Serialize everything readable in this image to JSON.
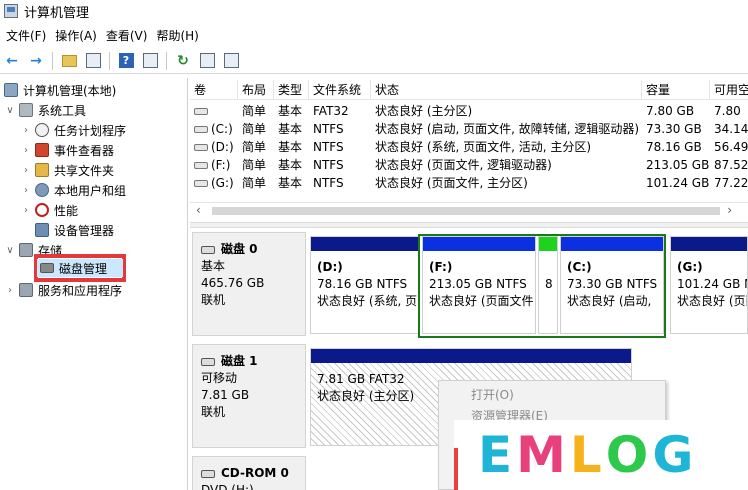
{
  "window": {
    "title": "计算机管理"
  },
  "menu": [
    {
      "label": "文件(F)"
    },
    {
      "label": "操作(A)"
    },
    {
      "label": "查看(V)"
    },
    {
      "label": "帮助(H)"
    }
  ],
  "toolbar": {
    "icons": [
      "back-arrow-icon",
      "forward-arrow-icon",
      "up-folder-icon",
      "show-hide-tree-icon",
      "help-icon",
      "help-pane-icon",
      "refresh-icon",
      "properties-icon",
      "export-icon"
    ]
  },
  "tree": {
    "root": "计算机管理(本地)",
    "system_tools": "系统工具",
    "task_scheduler": "任务计划程序",
    "event_viewer": "事件查看器",
    "shared_folders": "共享文件夹",
    "local_users": "本地用户和组",
    "performance": "性能",
    "device_manager": "设备管理器",
    "storage": "存储",
    "disk_management": "磁盘管理",
    "services_apps": "服务和应用程序"
  },
  "volumes": {
    "headers": [
      "卷",
      "布局",
      "类型",
      "文件系统",
      "状态",
      "容量",
      "可用空"
    ],
    "rows": [
      {
        "vol": "",
        "layout": "简单",
        "type": "基本",
        "fs": "FAT32",
        "status": "状态良好 (主分区)",
        "capacity": "7.80 GB",
        "free": "7.80"
      },
      {
        "vol": "(C:)",
        "layout": "简单",
        "type": "基本",
        "fs": "NTFS",
        "status": "状态良好 (启动, 页面文件, 故障转储, 逻辑驱动器)",
        "capacity": "73.30 GB",
        "free": "34.14"
      },
      {
        "vol": "(D:)",
        "layout": "简单",
        "type": "基本",
        "fs": "NTFS",
        "status": "状态良好 (系统, 页面文件, 活动, 主分区)",
        "capacity": "78.16 GB",
        "free": "56.49"
      },
      {
        "vol": "(F:)",
        "layout": "简单",
        "type": "基本",
        "fs": "NTFS",
        "status": "状态良好 (页面文件, 逻辑驱动器)",
        "capacity": "213.05 GB",
        "free": "87.52"
      },
      {
        "vol": "(G:)",
        "layout": "简单",
        "type": "基本",
        "fs": "NTFS",
        "status": "状态良好 (页面文件, 主分区)",
        "capacity": "101.24 GB",
        "free": "77.22"
      }
    ]
  },
  "disks": [
    {
      "name": "磁盘 0",
      "kind": "基本",
      "size": "465.76 GB",
      "state": "联机",
      "partitions": [
        {
          "name": "(D:)",
          "size": "78.16 GB NTFS",
          "status": "状态良好 (系统, 页"
        },
        {
          "name": "(F:)",
          "size": "213.05 GB NTFS",
          "status": "状态良好 (页面文件"
        },
        {
          "name": "",
          "size": "",
          "status": "8"
        },
        {
          "name": "(C:)",
          "size": "73.30 GB NTFS",
          "status": "状态良好 (启动, "
        },
        {
          "name": "(G:)",
          "size": "101.24 GB NTFS",
          "status": "状态良好 (页面文件"
        }
      ]
    },
    {
      "name": "磁盘 1",
      "kind": "可移动",
      "size": "7.81 GB",
      "state": "联机",
      "partitions": [
        {
          "name": "",
          "size": "7.81 GB FAT32",
          "status": "状态良好 (主分区)"
        }
      ]
    },
    {
      "name": "CD-ROM 0",
      "kind": "DVD (H:)",
      "size": "",
      "state": "",
      "partitions": []
    }
  ],
  "context_menu": [
    {
      "label": "打开(O)"
    },
    {
      "label": "资源管理器(E)"
    }
  ],
  "watermark": {
    "letters": [
      "E",
      "M",
      "L",
      "O",
      "G"
    ],
    "colors": [
      "#1fb5d6",
      "#e8407a",
      "#f6b21b",
      "#2cc94a",
      "#1fb5d6"
    ]
  }
}
